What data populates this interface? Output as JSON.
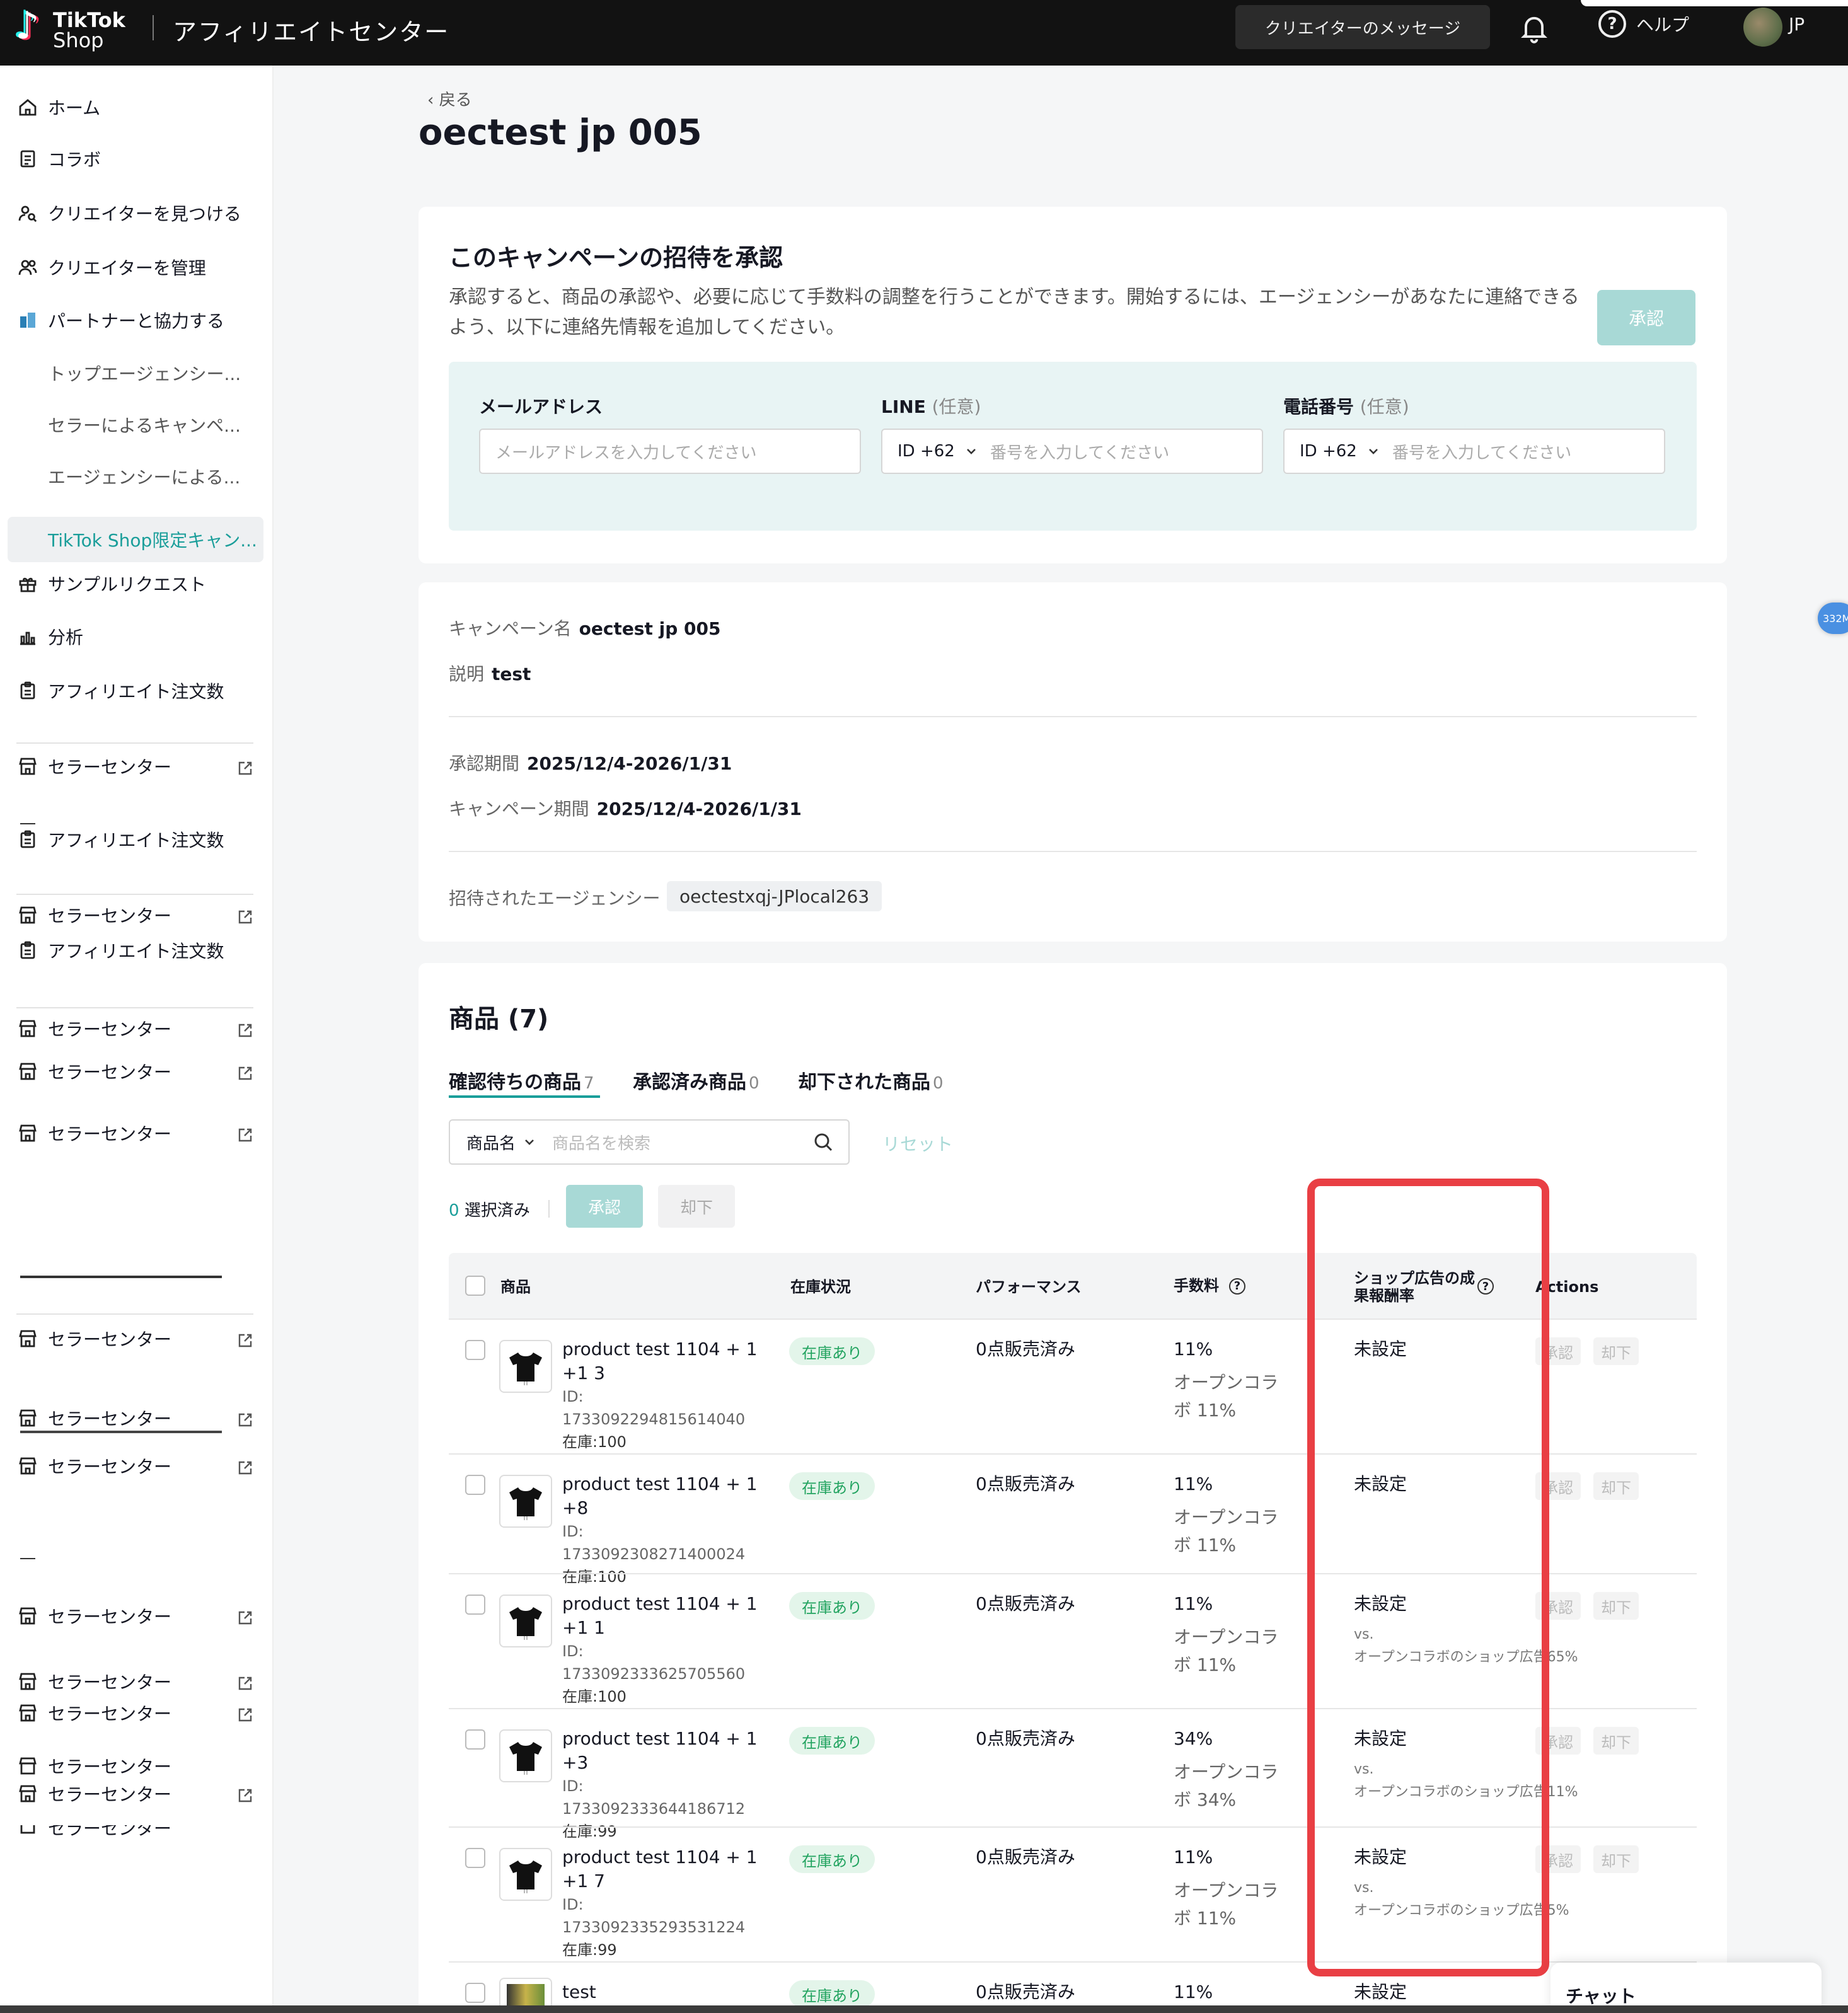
{
  "header": {
    "logo_line1": "TikTok",
    "logo_line2": "Shop",
    "app_title": "アフィリエイトセンター",
    "creator_messages": "クリエイターのメッセージ",
    "help": "ヘルプ",
    "region": "JP"
  },
  "sidebar": {
    "items": [
      {
        "label": "ホーム",
        "icon": "home-icon"
      },
      {
        "label": "コラボ",
        "icon": "collab-icon"
      },
      {
        "label": "クリエイターを見つける",
        "icon": "find-creator-icon"
      },
      {
        "label": "クリエイターを管理",
        "icon": "manage-creator-icon"
      },
      {
        "label": "パートナーと協力する",
        "icon": "partner-icon"
      }
    ],
    "sub_items": [
      "トップエージェンシー...",
      "セラーによるキャンペ...",
      "エージェンシーによる...",
      "TikTok Shop限定キャン..."
    ],
    "items2": [
      {
        "label": "サンプルリクエスト",
        "icon": "gift-icon"
      },
      {
        "label": "分析",
        "icon": "analytics-icon"
      },
      {
        "label": "アフィリエイト注文数",
        "icon": "clipboard-icon"
      }
    ],
    "seller_center": "セラーセンター",
    "affiliate_orders": "アフィリエイト注文数"
  },
  "page": {
    "back": "戻る",
    "title": "oectest jp 005"
  },
  "invite": {
    "heading": "このキャンペーンの招待を承認",
    "description": "承認すると、商品の承認や、必要に応じて手数料の調整を行うことができます。開始するには、エージェンシーがあなたに連絡できるよう、以下に連絡先情報を追加してください。",
    "approve_button": "承認",
    "email_label": "メールアドレス",
    "email_placeholder": "メールアドレスを入力してください",
    "line_label": "LINE",
    "optional": "(任意)",
    "line_code": "ID +62",
    "line_placeholder": "番号を入力してください",
    "phone_label": "電話番号",
    "phone_code": "ID +62",
    "phone_placeholder": "番号を入力してください"
  },
  "campaign": {
    "name_label": "キャンペーン名",
    "name": "oectest jp 005",
    "desc_label": "説明",
    "desc": "test",
    "approval_period_label": "承認期間",
    "approval_period": "2025/12/4-2026/1/31",
    "campaign_period_label": "キャンペーン期間",
    "campaign_period": "2025/12/4-2026/1/31",
    "agency_label": "招待されたエージェンシー",
    "agency": "oectestxqj-JPlocal263"
  },
  "products": {
    "heading": "商品 (7)",
    "tabs": [
      {
        "label": "確認待ちの商品",
        "count": "7"
      },
      {
        "label": "承認済み商品",
        "count": "0"
      },
      {
        "label": "却下された商品",
        "count": "0"
      }
    ],
    "search_select": "商品名",
    "search_placeholder": "商品名を検索",
    "reset": "リセット",
    "selected_count": "0",
    "selected_label": "選択済み",
    "approve": "承認",
    "reject": "却下",
    "columns": {
      "product": "商品",
      "stock": "在庫状況",
      "performance": "パフォーマンス",
      "commission": "手数料",
      "ads_rate_1": "ショップ広告の成",
      "ads_rate_2": "果報酬率",
      "actions": "Actions"
    },
    "rows": [
      {
        "name": "product test 1104 + 1 +1 3",
        "id": "ID: 1733092294815614040",
        "stock": "在庫:100",
        "stock_status": "在庫あり",
        "performance": "0点販売済み",
        "commission": "11%",
        "open_collab_1": "オープンコラ",
        "open_collab_2": "ボ 11%",
        "ads": "未設定",
        "vs1": "",
        "vs2": ""
      },
      {
        "name": "product test 1104 + 1 +8",
        "id": "ID: 1733092308271400024",
        "stock": "在庫:100",
        "stock_status": "在庫あり",
        "performance": "0点販売済み",
        "commission": "11%",
        "open_collab_1": "オープンコラ",
        "open_collab_2": "ボ 11%",
        "ads": "未設定",
        "vs1": "",
        "vs2": ""
      },
      {
        "name": "product test 1104 + 1 +1 1",
        "id": "ID: 1733092333625705560",
        "stock": "在庫:100",
        "stock_status": "在庫あり",
        "performance": "0点販売済み",
        "commission": "11%",
        "open_collab_1": "オープンコラ",
        "open_collab_2": "ボ 11%",
        "ads": "未設定",
        "vs1": "vs.",
        "vs2": "オープンコラボのショップ広告65%"
      },
      {
        "name": "product test 1104 + 1 +3",
        "id": "ID: 1733092333644186712",
        "stock": "在庫:99",
        "stock_status": "在庫あり",
        "performance": "0点販売済み",
        "commission": "34%",
        "open_collab_1": "オープンコラ",
        "open_collab_2": "ボ 34%",
        "ads": "未設定",
        "vs1": "vs.",
        "vs2": "オープンコラボのショップ広告11%"
      },
      {
        "name": "product test 1104 + 1 +1 7",
        "id": "ID: 1733092335293531224",
        "stock": "在庫:99",
        "stock_status": "在庫あり",
        "performance": "0点販売済み",
        "commission": "11%",
        "open_collab_1": "オープンコラ",
        "open_collab_2": "ボ 11%",
        "ads": "未設定",
        "vs1": "vs.",
        "vs2": "オープンコラボのショップ広告5%"
      },
      {
        "name": "test",
        "id": "",
        "stock": "",
        "stock_status": "在庫あり",
        "performance": "0点販売済み",
        "commission": "11%",
        "open_collab_1": "",
        "open_collab_2": "",
        "ads": "未設定",
        "vs1": "",
        "vs2": ""
      }
    ],
    "row_approve": "承認",
    "row_reject": "却下"
  },
  "float_badge": "332M",
  "chat": "チャット",
  "colors": {
    "accent": "#1a9e9a",
    "accent_disabled": "#a8d9d6",
    "highlight": "#e93f44",
    "header_bg": "#121212"
  }
}
